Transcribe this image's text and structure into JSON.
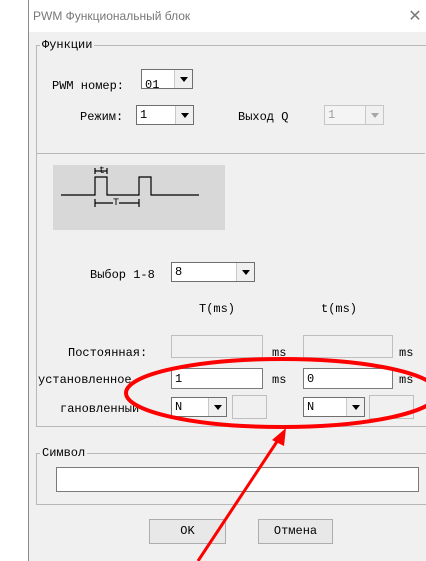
{
  "window": {
    "title": "PWM Функциональный блок",
    "close_symbol": "✕"
  },
  "functions": {
    "group_title": "Функции",
    "pwm_number_label": "PWM номер:",
    "pwm_number_value": "01",
    "mode_label": "Режим:",
    "mode_value": "1",
    "output_q_label": "Выход Q",
    "output_q_value": "1",
    "diagram": {
      "t_label": "t",
      "T_label": "T"
    },
    "select_label": "Выбор 1-8",
    "select_value": "8",
    "col_T_header": "T(ms)",
    "col_t_header": "t(ms)",
    "rows": {
      "constant_label": "Постоянная:",
      "set_label": "установленное",
      "set_T_value": "1",
      "set_t_value": "0",
      "ms_unit": "ms",
      "installed_label": "гановленный",
      "installed_T_combo": "N",
      "installed_t_combo": "N"
    }
  },
  "symbol": {
    "group_title": "Символ",
    "value": ""
  },
  "buttons": {
    "ok": "OK",
    "cancel": "Отмена"
  },
  "colors": {
    "annotation": "#ff0000",
    "window_bg": "#f0f0f0"
  }
}
